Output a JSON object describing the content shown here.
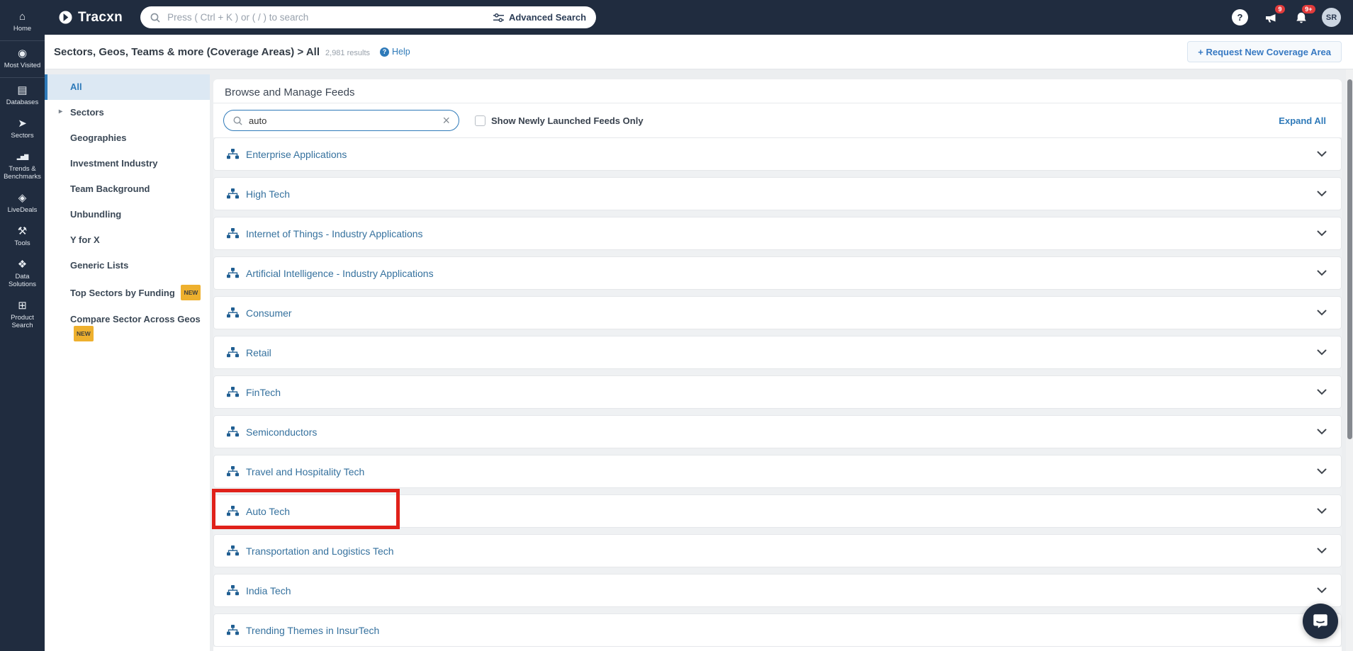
{
  "colors": {
    "topbar_bg": "#202c3f",
    "accent_blue": "#2e7ab9",
    "feed_link_blue": "#35719e",
    "annotation_red": "#e0211a",
    "badge_yellow": "#eeb02e",
    "notification_red": "#e23b3b"
  },
  "topbar": {
    "logo_text": "Tracxn",
    "search_placeholder": "Press ( Ctrl + K ) or ( / ) to search",
    "advanced_search_label": "Advanced Search",
    "help_glyph": "?",
    "megaphone_badge": "9",
    "bell_badge": "9+",
    "avatar_initials": "SR"
  },
  "sidebar": {
    "items": [
      {
        "label": "Home",
        "icon": "home-icon",
        "glyph": "⌂",
        "divider_after": true
      },
      {
        "label": "Most Visited",
        "icon": "eye-icon",
        "glyph": "◉",
        "divider_after": true
      },
      {
        "label": "Databases",
        "icon": "database-icon",
        "glyph": "▤"
      },
      {
        "label": "Sectors",
        "icon": "send-icon",
        "glyph": "➤"
      },
      {
        "label": "Trends & Benchmarks",
        "icon": "bar-chart-icon",
        "glyph": "▂▅▇",
        "bars": true
      },
      {
        "label": "LiveDeals",
        "icon": "handshake-icon",
        "glyph": "◈"
      },
      {
        "label": "Tools",
        "icon": "tools-icon",
        "glyph": "⚒"
      },
      {
        "label": "Data Solutions",
        "icon": "puzzle-icon",
        "glyph": "❖"
      },
      {
        "label": "Product Search",
        "icon": "grid-search-icon",
        "glyph": "⊞"
      }
    ]
  },
  "breadcrumb": {
    "title": "Sectors, Geos, Teams & more (Coverage Areas) > All",
    "results_count": "2,981 results",
    "help_icon_glyph": "?",
    "help_label": "Help",
    "request_button": "+ Request New Coverage Area"
  },
  "subnav": {
    "items": [
      {
        "label": "All",
        "selected": true
      },
      {
        "label": "Sectors",
        "expandable": true
      },
      {
        "label": "Geographies"
      },
      {
        "label": "Investment Industry"
      },
      {
        "label": "Team Background"
      },
      {
        "label": "Unbundling"
      },
      {
        "label": "Y for X"
      },
      {
        "label": "Generic Lists"
      },
      {
        "label": "Top Sectors by Funding",
        "badge": "NEW"
      },
      {
        "label": "Compare Sector Across Geos",
        "badge": "NEW"
      }
    ]
  },
  "main": {
    "title": "Browse and Manage Feeds",
    "search_value": "auto",
    "checkbox_label": "Show Newly Launched Feeds Only",
    "checkbox_checked": false,
    "expand_all_label": "Expand All",
    "feeds": [
      {
        "label": "Enterprise Applications"
      },
      {
        "label": "High Tech"
      },
      {
        "label": "Internet of Things - Industry Applications"
      },
      {
        "label": "Artificial Intelligence - Industry Applications"
      },
      {
        "label": "Consumer"
      },
      {
        "label": "Retail"
      },
      {
        "label": "FinTech"
      },
      {
        "label": "Semiconductors"
      },
      {
        "label": "Travel and Hospitality Tech"
      },
      {
        "label": "Auto Tech",
        "annotated": true
      },
      {
        "label": "Transportation and Logistics Tech"
      },
      {
        "label": "India Tech"
      },
      {
        "label": "Trending Themes in InsurTech"
      }
    ]
  }
}
